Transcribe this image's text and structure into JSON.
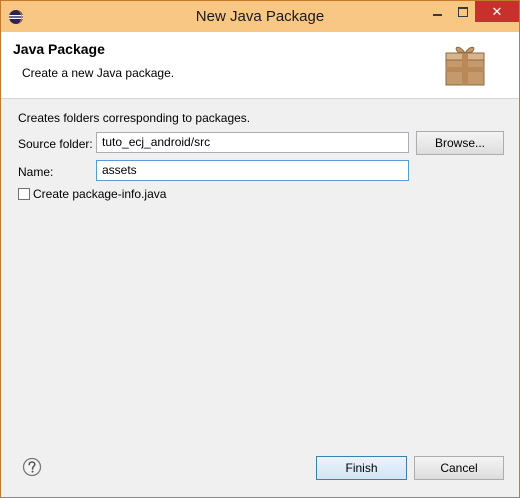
{
  "window": {
    "title": "New Java Package",
    "controls": {
      "minimize": "minimize",
      "maximize": "maximize",
      "close": "✕"
    }
  },
  "banner": {
    "heading": "Java Package",
    "description": "Create a new Java package."
  },
  "form": {
    "info": "Creates folders corresponding to packages.",
    "source_folder_label": "Source folder:",
    "source_folder_value": "tuto_ecj_android/src",
    "browse_label": "Browse...",
    "name_label": "Name:",
    "name_value": "assets",
    "create_package_info_label": "Create package-info.java",
    "create_package_info_checked": false
  },
  "footer": {
    "finish_label": "Finish",
    "cancel_label": "Cancel"
  },
  "colors": {
    "titlebar": "#f9c784",
    "close_button": "#c7302b",
    "border": "#c47a2c"
  },
  "icons": {
    "app": "eclipse-icon",
    "banner": "package-box-icon",
    "help": "help-icon"
  }
}
